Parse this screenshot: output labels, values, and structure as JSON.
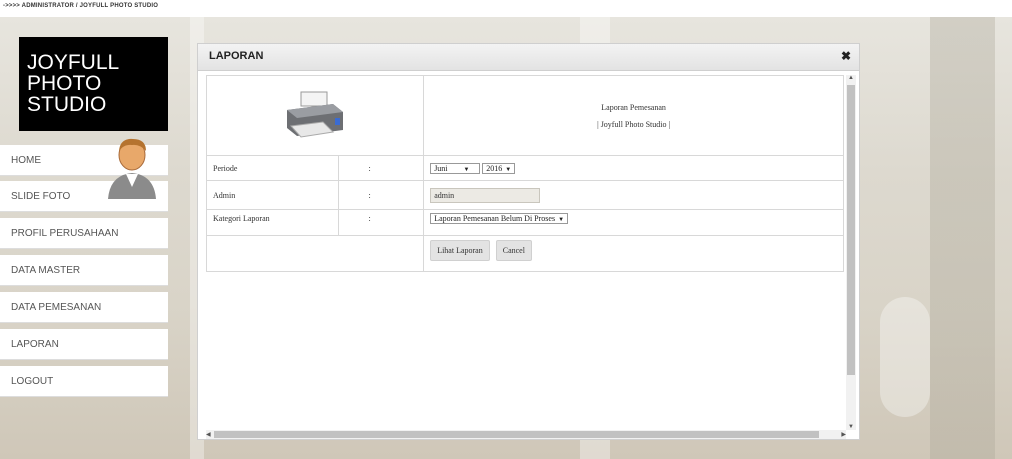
{
  "breadcrumb": "->>>> ADMINISTRATOR / JOYFULL PHOTO STUDIO",
  "logo": "JOYFULL\nPHOTO\nSTUDIO",
  "menu": [
    "HOME",
    "SLIDE FOTO",
    "PROFIL PERUSAHAAN",
    "DATA MASTER",
    "DATA PEMESANAN",
    "LAPORAN",
    "LOGOUT"
  ],
  "panel": {
    "title": "LAPORAN",
    "close": "✖",
    "report_title": "Laporan Pemesanan",
    "report_subtitle": "| Joyfull Photo Studio |"
  },
  "form": {
    "periode_label": "Periode",
    "admin_label": "Admin",
    "kategori_label": "Kategori Laporan",
    "colon": ":",
    "month": "Juni",
    "year": "2016",
    "admin_value": "admin",
    "kategori_value": "Laporan Pemesanan Belum Di Proses",
    "lihat_button": "Lihat Laporan",
    "cancel_button": "Cancel"
  },
  "icons": {
    "printer": "printer-icon",
    "avatar": "user-avatar-icon",
    "close": "close-icon"
  }
}
